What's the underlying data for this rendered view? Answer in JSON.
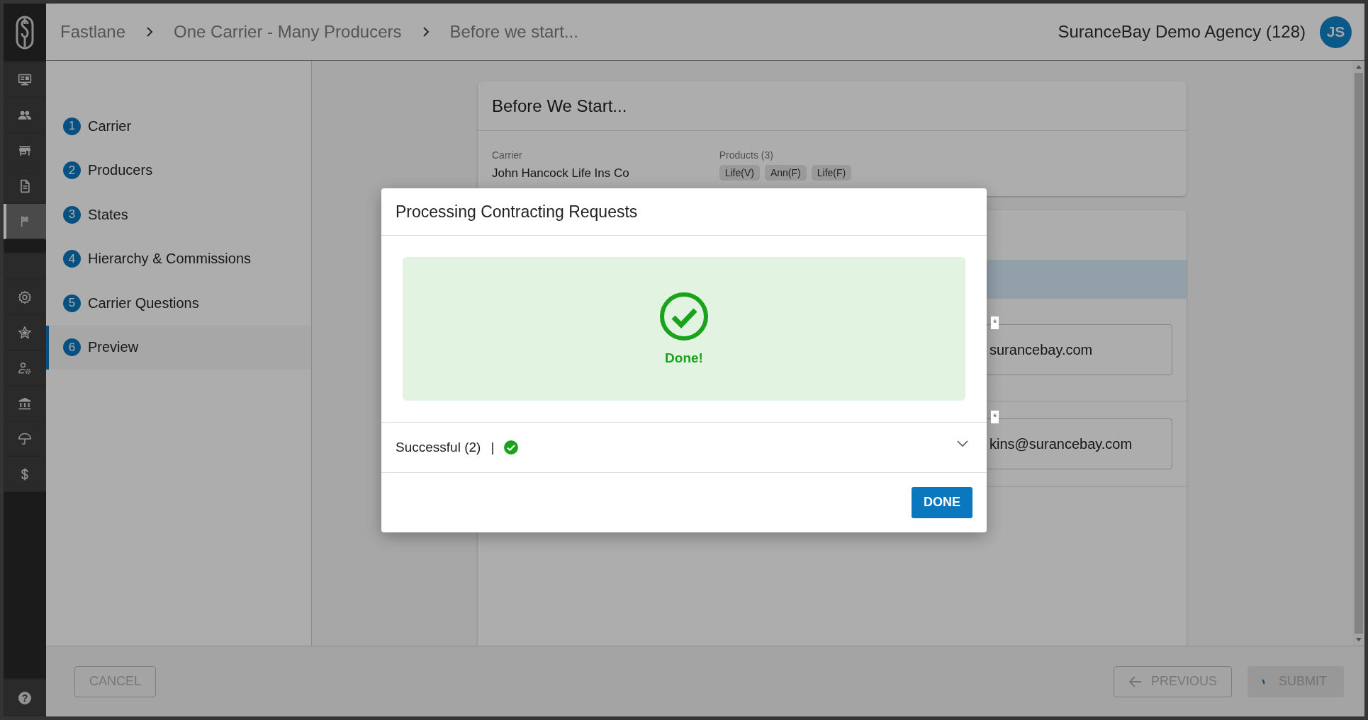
{
  "rail": {
    "top_items": [
      {
        "kind": "monitor",
        "selected": false
      },
      {
        "kind": "people",
        "selected": false
      },
      {
        "kind": "store",
        "selected": false
      },
      {
        "kind": "document",
        "selected": false
      },
      {
        "kind": "flag",
        "selected": true
      }
    ],
    "bottom_items": [
      {
        "kind": "gear",
        "selected": false
      },
      {
        "kind": "star",
        "selected": false
      },
      {
        "kind": "person-gear",
        "selected": false
      },
      {
        "kind": "bank",
        "selected": false
      },
      {
        "kind": "umbrella",
        "selected": false
      },
      {
        "kind": "dollar",
        "selected": false
      }
    ],
    "help": {
      "label": "?"
    }
  },
  "header": {
    "breadcrumbs": [
      "Fastlane",
      "One Carrier - Many Producers",
      "Before we start..."
    ],
    "agency": "SuranceBay Demo Agency (128)",
    "avatar": "JS"
  },
  "steps": [
    {
      "number": "1",
      "label": "Carrier",
      "selected": false
    },
    {
      "number": "2",
      "label": "Producers",
      "selected": false
    },
    {
      "number": "3",
      "label": "States",
      "selected": false
    },
    {
      "number": "4",
      "label": "Hierarchy & Commissions",
      "selected": false
    },
    {
      "number": "5",
      "label": "Carrier Questions",
      "selected": false
    },
    {
      "number": "6",
      "label": "Preview",
      "selected": true
    }
  ],
  "summary_card": {
    "title": "Before We Start...",
    "carrier_label": "Carrier",
    "carrier": "John Hancock Life Ins Co",
    "products_label": "Products (3)",
    "products": [
      "Life(V)",
      "Ann(F)",
      "Life(F)"
    ]
  },
  "fields": [
    {
      "marker": "*",
      "value": "surancebay.com"
    },
    {
      "marker": "*",
      "value": "kins@surancebay.com"
    }
  ],
  "footer": {
    "cancel": {
      "label": "CANCEL",
      "disabled": true
    },
    "previous": {
      "label": "PREVIOUS",
      "disabled": true
    },
    "submit": {
      "label": "SUBMIT",
      "disabled": true,
      "busy": true
    }
  },
  "dialog": {
    "title": "Processing Contracting Requests",
    "status": "Done!",
    "result": "Successful (2)",
    "separator": "|",
    "expanded": false,
    "button": "DONE"
  }
}
